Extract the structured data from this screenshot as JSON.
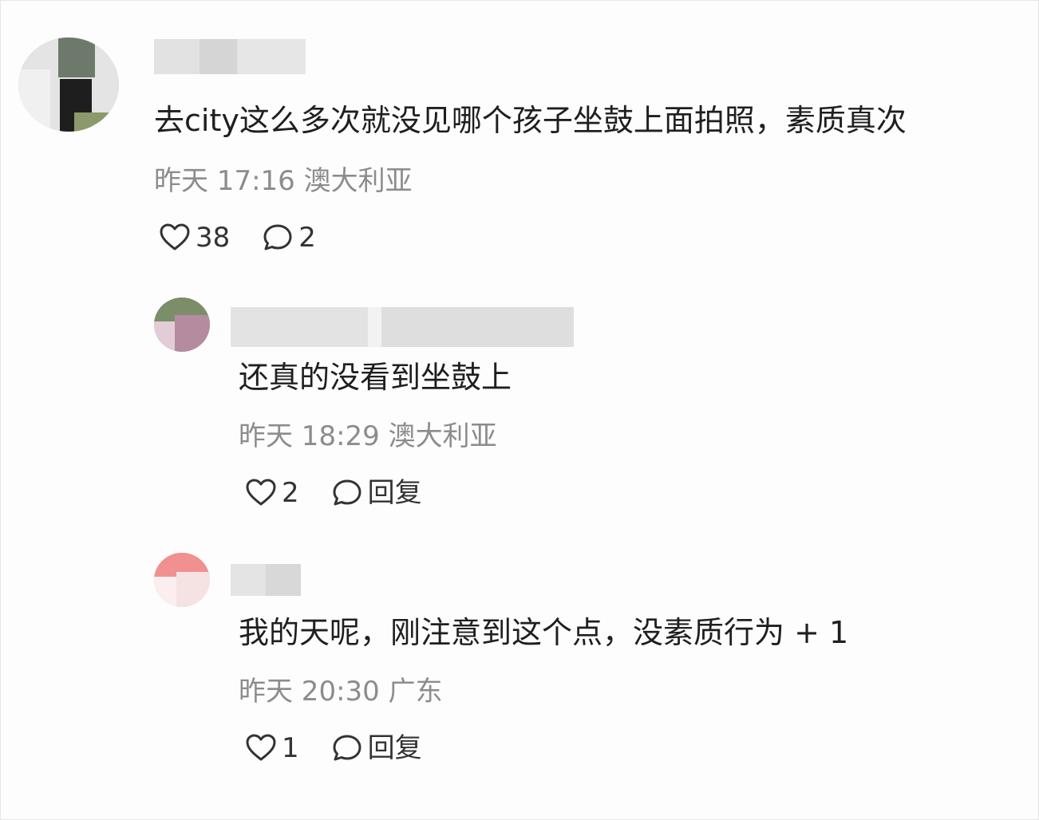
{
  "comments": [
    {
      "text": "去city这么多次就没见哪个孩子坐鼓上面拍照，素质真次",
      "meta": "昨天 17:16 澳大利亚",
      "likes": "38",
      "replies": "2"
    }
  ],
  "replies": [
    {
      "text": "还真的没看到坐鼓上",
      "meta": "昨天 18:29 澳大利亚",
      "likes": "2",
      "reply_label": "回复"
    },
    {
      "text": "我的天呢，刚注意到这个点，没素质行为 + 1",
      "meta": "昨天 20:30 广东",
      "likes": "1",
      "reply_label": "回复"
    }
  ],
  "icons": {
    "like": "heart-outline-icon",
    "comment": "speech-bubble-icon"
  },
  "colors": {
    "text": "#1f1f1f",
    "meta": "#8c8c8c",
    "background": "#ffffff"
  }
}
